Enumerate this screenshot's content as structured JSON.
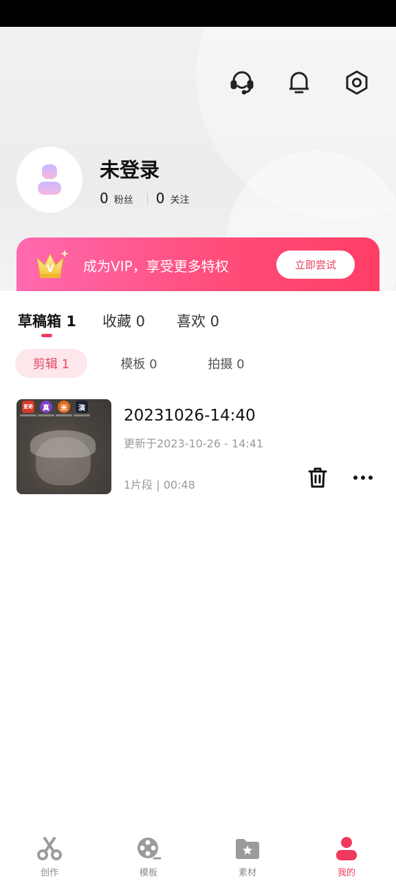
{
  "profile": {
    "title": "未登录",
    "fans_count": "0",
    "fans_label": "粉丝",
    "following_count": "0",
    "following_label": "关注"
  },
  "header_icons": [
    "headset-icon",
    "bell-icon",
    "settings-icon"
  ],
  "vip": {
    "crown_letter": "V",
    "text": "成为VIP，享受更多特权",
    "button": "立即尝试"
  },
  "main_tabs": [
    {
      "label": "草稿箱 1",
      "active": true
    },
    {
      "label": "收藏 0",
      "active": false
    },
    {
      "label": "喜欢 0",
      "active": false
    }
  ],
  "sub_tabs": [
    {
      "label": "剪辑 1",
      "active": true
    },
    {
      "label": "模板 0",
      "active": false
    },
    {
      "label": "拍摄 0",
      "active": false
    }
  ],
  "drafts": [
    {
      "title": "20231026-14:40",
      "updated": "更新于2023-10-26 - 14:41",
      "meta": "1片段 | 00:48",
      "thumb_apps": [
        "爱奇",
        "真",
        "米",
        "演"
      ]
    }
  ],
  "bottom_nav": [
    {
      "label": "创作",
      "icon": "scissors-icon",
      "active": false
    },
    {
      "label": "模板",
      "icon": "film-reel-icon",
      "active": false
    },
    {
      "label": "素材",
      "icon": "folder-star-icon",
      "active": false
    },
    {
      "label": "我的",
      "icon": "person-icon",
      "active": true
    }
  ],
  "colors": {
    "accent": "#f0395e",
    "vip_gradient_start": "#ff6ab0",
    "vip_gradient_end": "#ff3e67",
    "sub_tab_active_bg": "#fde7ea"
  }
}
